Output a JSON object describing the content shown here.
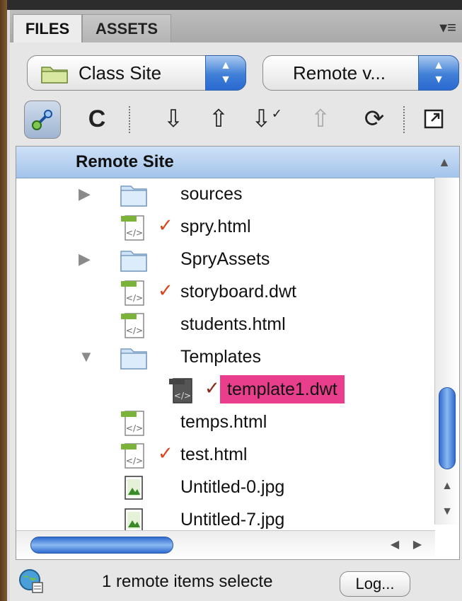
{
  "tabs": [
    {
      "label": "FILES",
      "active": true
    },
    {
      "label": "ASSETS",
      "active": false
    }
  ],
  "panel_menu_icon": "panel-options-icon",
  "site_select": {
    "value": "Class Site",
    "icon": "folder-icon"
  },
  "view_select": {
    "value": "Remote v..."
  },
  "toolbar": {
    "icons": [
      "connect-icon",
      "refresh-icon",
      "get-icon",
      "put-icon",
      "check-out-icon",
      "check-in-icon",
      "synchronize-icon",
      "expand-icon"
    ]
  },
  "tree": {
    "header": "Remote Site",
    "rows": [
      {
        "name": "sources",
        "type": "folder",
        "expandable": true,
        "expanded": false,
        "checked": false
      },
      {
        "name": "spry.html",
        "type": "html",
        "checked": true
      },
      {
        "name": "SpryAssets",
        "type": "folder",
        "expandable": true,
        "expanded": false,
        "checked": false
      },
      {
        "name": "storyboard.dwt",
        "type": "html",
        "checked": true
      },
      {
        "name": "students.html",
        "type": "html",
        "checked": false
      },
      {
        "name": "Templates",
        "type": "folder",
        "expandable": true,
        "expanded": true,
        "checked": false
      },
      {
        "name": "template1.dwt",
        "type": "template",
        "checked": true,
        "selected": true,
        "child": true
      },
      {
        "name": "temps.html",
        "type": "html",
        "checked": false
      },
      {
        "name": "test.html",
        "type": "html",
        "checked": true
      },
      {
        "name": "Untitled-0.jpg",
        "type": "image",
        "checked": false
      },
      {
        "name": "Untitled-7.jpg",
        "type": "image",
        "checked": false
      }
    ]
  },
  "status": {
    "text": "1 remote items selecte",
    "log_button": "Log..."
  },
  "colors": {
    "selection": "#e83e8c",
    "header": "#a3c3ea",
    "accent": "#2f6bd0",
    "checkmark": "#d9461e"
  }
}
